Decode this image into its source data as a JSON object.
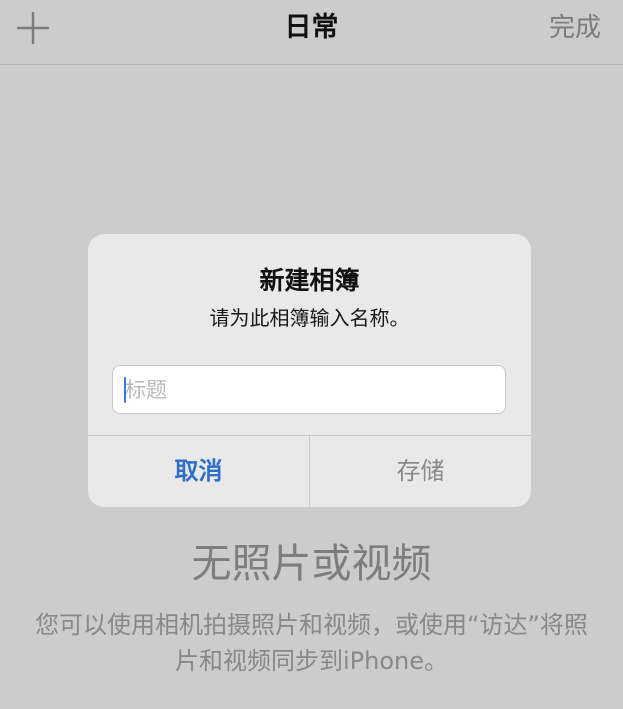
{
  "navbar": {
    "add_icon": "plus-icon",
    "title": "日常",
    "done_label": "完成"
  },
  "alert": {
    "title": "新建相簿",
    "message": "请为此相簿输入名称。",
    "input": {
      "value": "",
      "placeholder": "标题"
    },
    "cancel_label": "取消",
    "save_label": "存储"
  },
  "empty_state": {
    "heading": "无照片或视频",
    "description": "您可以使用相机拍摄照片和视频，或使用“访达”将照片和视频同步到iPhone。"
  },
  "colors": {
    "background": "#cccccc",
    "accent": "#2f6fc7",
    "dialog": "#e9e9e9"
  }
}
